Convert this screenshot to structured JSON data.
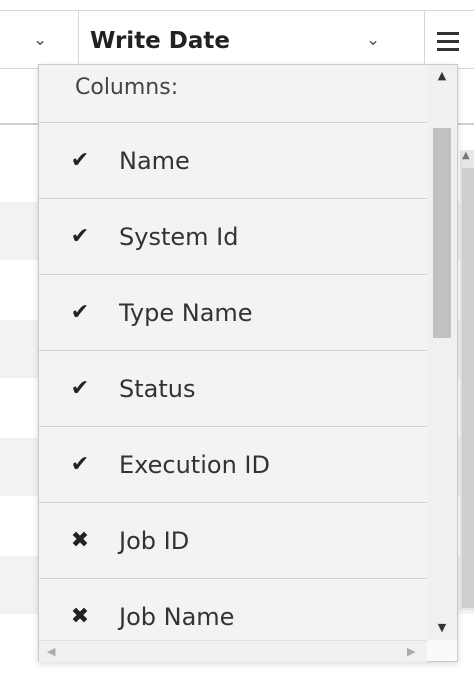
{
  "grid": {
    "header_column_title": "Write Date",
    "chevron_glyph": "⌄",
    "menu_icon": "hamburger-menu-icon"
  },
  "column_menu": {
    "heading": "Columns:",
    "items": [
      {
        "label": "Name",
        "visible": true,
        "glyph": "✔"
      },
      {
        "label": "System Id",
        "visible": true,
        "glyph": "✔"
      },
      {
        "label": "Type Name",
        "visible": true,
        "glyph": "✔"
      },
      {
        "label": "Status",
        "visible": true,
        "glyph": "✔"
      },
      {
        "label": "Execution ID",
        "visible": true,
        "glyph": "✔"
      },
      {
        "label": "Job ID",
        "visible": false,
        "glyph": "✖"
      },
      {
        "label": "Job Name",
        "visible": false,
        "glyph": "✖"
      }
    ]
  },
  "scroll": {
    "up_glyph": "▲",
    "down_glyph": "▼",
    "left_glyph": "◀",
    "right_glyph": "▶"
  }
}
